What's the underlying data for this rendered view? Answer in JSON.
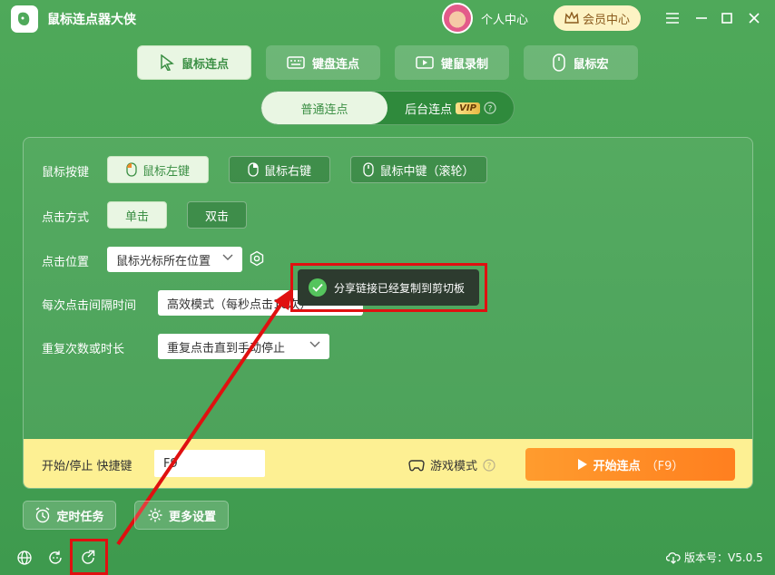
{
  "app": {
    "title": "鼠标连点器大侠"
  },
  "header": {
    "user_center": "个人中心",
    "vip_center": "会员中心"
  },
  "mode_tabs": [
    {
      "label": "鼠标连点",
      "icon": "cursor-icon"
    },
    {
      "label": "键盘连点",
      "icon": "keyboard-icon"
    },
    {
      "label": "键鼠录制",
      "icon": "record-icon"
    },
    {
      "label": "鼠标宏",
      "icon": "mouse-icon"
    }
  ],
  "sub_tabs": {
    "normal": "普通连点",
    "background": "后台连点",
    "vip": "VIP"
  },
  "settings": {
    "mouse_key_label": "鼠标按键",
    "mouse_buttons": [
      "鼠标左键",
      "鼠标右键",
      "鼠标中键（滚轮）"
    ],
    "click_mode_label": "点击方式",
    "click_modes": [
      "单击",
      "双击"
    ],
    "click_position_label": "点击位置",
    "click_position_value": "鼠标光标所在位置",
    "interval_label": "每次点击间隔时间",
    "interval_value": "高效模式（每秒点击10次）",
    "repeat_label": "重复次数或时长",
    "repeat_value": "重复点击直到手动停止"
  },
  "footer": {
    "hotkey_label": "开始/停止 快捷键",
    "hotkey_value": "F9",
    "game_mode": "游戏模式",
    "start_button": "开始连点",
    "start_hotkey": "（F9）"
  },
  "toast": {
    "message": "分享链接已经复制到剪切板"
  },
  "bottom": {
    "timer_task": "定时任务",
    "more_settings": "更多设置"
  },
  "version": {
    "label": "版本号：V5.0.5"
  }
}
